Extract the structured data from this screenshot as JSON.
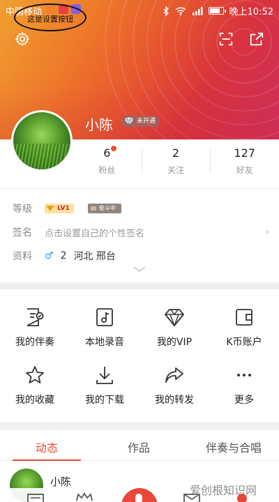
{
  "status_bar": {
    "carrier": "中国移动",
    "time": "晚上10:52",
    "battery_level": 0.85
  },
  "annotation": {
    "text": "这是设置按钮"
  },
  "header": {
    "icons": {
      "settings": "gear-icon",
      "scan": "scan-icon",
      "share": "share-icon"
    }
  },
  "profile": {
    "name": "小陈",
    "vip_status": "未开通"
  },
  "stats": [
    {
      "value": "6",
      "label": "粉丝",
      "has_dot": true
    },
    {
      "value": "2",
      "label": "关注",
      "has_dot": false
    },
    {
      "value": "127",
      "label": "好友",
      "has_dot": false
    }
  ],
  "info": {
    "level_label": "等级",
    "level_badge": "LV1",
    "stage_badge": "奋斗中",
    "signature_label": "签名",
    "signature_placeholder": "点击设置自己的个性签名",
    "profile_label": "资料",
    "gender_symbol": "♂",
    "age": "2",
    "location": "河北 邢台"
  },
  "menu": [
    {
      "label": "我的伴奏",
      "icon": "accompaniment-icon"
    },
    {
      "label": "本地录音",
      "icon": "local-recording-icon"
    },
    {
      "label": "我的VIP",
      "icon": "diamond-icon"
    },
    {
      "label": "K币账户",
      "icon": "wallet-icon"
    },
    {
      "label": "我的收藏",
      "icon": "star-icon"
    },
    {
      "label": "我的下载",
      "icon": "download-icon"
    },
    {
      "label": "我的转发",
      "icon": "forward-icon"
    },
    {
      "label": "更多",
      "icon": "more-icon"
    }
  ],
  "tabs": [
    {
      "label": "动态",
      "active": true
    },
    {
      "label": "作品",
      "active": false
    },
    {
      "label": "伴奏与合唱",
      "active": false
    }
  ],
  "feed": {
    "name": "小陈"
  },
  "watermark": "爱创根知识网",
  "colors": {
    "accent": "#e8483a",
    "banner_start": "#f0a030",
    "banner_end": "#cf2f5d"
  }
}
